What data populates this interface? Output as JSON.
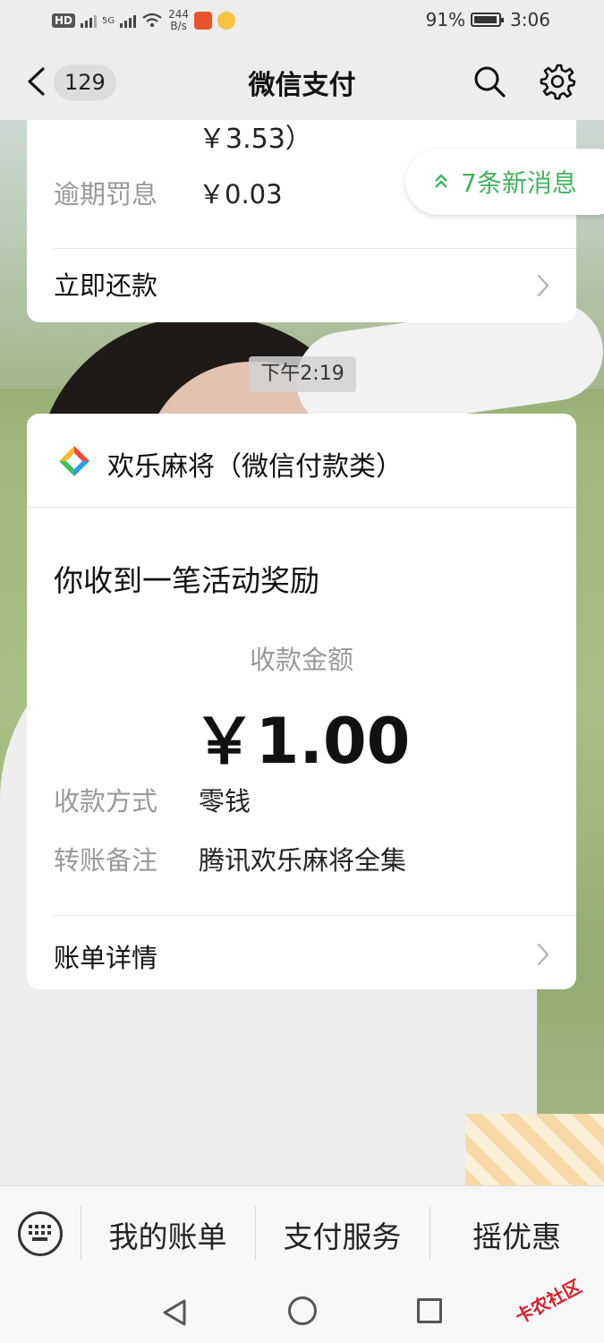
{
  "status_bar": {
    "hd": "HD",
    "network": "5G",
    "speed_value": "244",
    "speed_unit": "B/s",
    "battery": "91%",
    "time": "3:06"
  },
  "nav": {
    "back_badge": "129",
    "title": "微信支付"
  },
  "card_previous": {
    "amount_continued": "￥3.53）",
    "penalty_label": "逾期罚息",
    "penalty_value": "￥0.03",
    "action": "立即还款"
  },
  "new_messages": "7条新消息",
  "timestamp": "下午2:19",
  "card_reward": {
    "app_name": "欢乐麻将（微信付款类）",
    "title": "你收到一笔活动奖励",
    "amount_label": "收款金额",
    "amount": "￥1.00",
    "method_label": "收款方式",
    "method_value": "零钱",
    "note_label": "转账备注",
    "note_value": "腾讯欢乐麻将全集",
    "details": "账单详情"
  },
  "bottom_menu": {
    "items": [
      "我的账单",
      "支付服务",
      "摇优惠"
    ]
  },
  "watermark": "卡农社区",
  "icons": {
    "back": "chevron-left-icon",
    "search": "search-icon",
    "settings": "gear-icon",
    "keyboard": "keyboard-icon",
    "expand": "double-chevron-up-icon"
  },
  "colors": {
    "accent_green": "#41b35d",
    "watermark_red": "#d61e2a"
  }
}
